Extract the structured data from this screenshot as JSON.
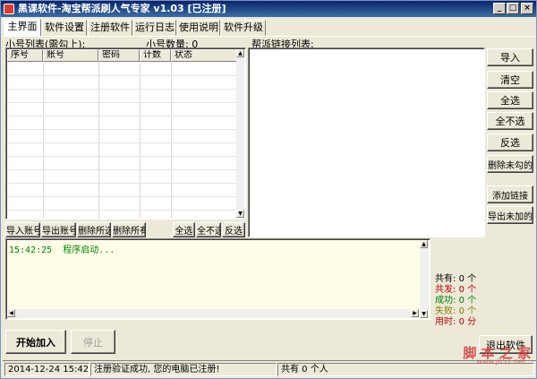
{
  "window": {
    "title": "黑课软件-淘宝帮派刷人气专家 v1.03 [已注册]",
    "minimize_label": "_",
    "maximize_label": "□",
    "close_label": "×"
  },
  "tabs": [
    {
      "label": "主界面",
      "active": true
    },
    {
      "label": "软件设置"
    },
    {
      "label": "注册软件"
    },
    {
      "label": "运行日志"
    },
    {
      "label": "使用说明"
    },
    {
      "label": "软件升级"
    }
  ],
  "accounts": {
    "section_label": "小号列表(需勾上):",
    "count_label": "小号数量: 0",
    "columns": [
      "序号",
      "账号",
      "密码",
      "计数",
      "状态"
    ],
    "rows": []
  },
  "links": {
    "section_label": "帮派链接列表:",
    "items": []
  },
  "right_buttons": [
    "导入",
    "清空",
    "全选",
    "全不选",
    "反选",
    "删除未勾的",
    "添加链接",
    "导出未加的"
  ],
  "account_buttons": [
    "导入账号",
    "导出账号",
    "删除所选",
    "删除所有",
    "全选",
    "全不选",
    "反选"
  ],
  "log": {
    "lines": [
      {
        "time": "15:42:25",
        "text": "程序启动..."
      }
    ]
  },
  "stats": [
    {
      "label": "共有:",
      "value": "0 个",
      "color": "#000000"
    },
    {
      "label": "共发:",
      "value": "0 个",
      "color": "#c00000"
    },
    {
      "label": "成功:",
      "value": "0 个",
      "color": "#008000"
    },
    {
      "label": "失败:",
      "value": "0 个",
      "color": "#808000"
    },
    {
      "label": "用时:",
      "value": "0 分",
      "color": "#c00000"
    }
  ],
  "controls": {
    "start_label": "开始加入",
    "stop_label": "停止",
    "exit_label": "退出软件"
  },
  "statusbar": {
    "datetime": "2014-12-24 15:42:27",
    "message": "注册验证成功, 您的电脑已注册!",
    "total": "共有 0 个人"
  },
  "watermark": {
    "text": "脚 本 之 家",
    "url": "www.jb51.net"
  }
}
